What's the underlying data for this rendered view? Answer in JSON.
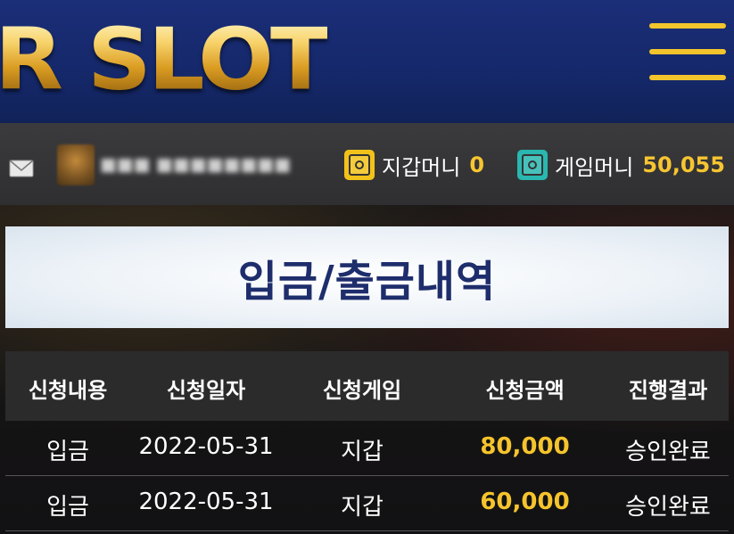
{
  "header": {
    "logo_text": "R SLOT",
    "menu_icon": "hamburger-menu-icon",
    "brand_color": "#f3c52c",
    "background": "#1b2e78"
  },
  "userbar": {
    "mail_icon": "mail-icon",
    "wallet": {
      "label": "지갑머니",
      "value": "0",
      "icon": "safe-icon"
    },
    "game": {
      "label": "게임머니",
      "value": "50,055",
      "icon": "safe-icon"
    }
  },
  "main": {
    "title": "입금/출금내역",
    "table": {
      "headers": [
        "신청내용",
        "신청일자",
        "신청게임",
        "신청금액",
        "진행결과"
      ],
      "rows": [
        [
          "입금",
          "2022-05-31",
          "지갑",
          "80,000",
          "승인완료"
        ],
        [
          "입금",
          "2022-05-31",
          "지갑",
          "60,000",
          "승인완료"
        ]
      ]
    }
  },
  "colors": {
    "accent_gold": "#f5c42c",
    "title_navy": "#1e2d6b",
    "teal_safe": "#29b7b0"
  }
}
